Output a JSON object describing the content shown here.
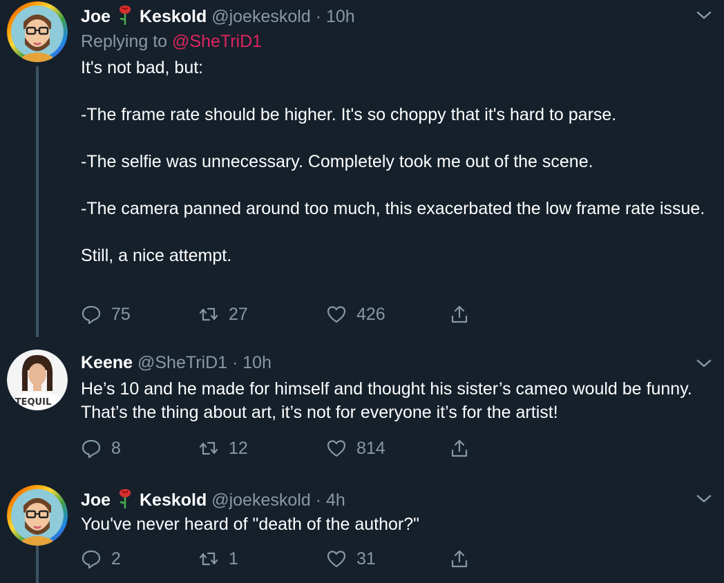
{
  "tweets": [
    {
      "first_name": "Joe",
      "last_name": "Keskold",
      "handle": "@joekeskold",
      "time": "· 10h",
      "replying_prefix": "Replying to",
      "replying_handle": "@SheTriD1",
      "paragraphs": [
        "It's not bad, but:",
        "-The frame rate should be higher. It's so choppy that it's hard to parse.",
        "-The selfie was unnecessary. Completely took me out of the scene.",
        "-The camera panned around too much, this exacerbated the low frame rate issue.",
        "Still, a nice attempt."
      ],
      "replies": "75",
      "retweets": "27",
      "likes": "426"
    },
    {
      "name": "Keene",
      "handle": "@SheTriD1",
      "time": "· 10h",
      "paragraphs": [
        "He’s 10 and he made for himself and thought his sister’s cameo would be funny. That’s the thing about art, it’s not for everyone it’s for the artist!"
      ],
      "avatar_text": "TEQUIL",
      "replies": "8",
      "retweets": "12",
      "likes": "814"
    },
    {
      "first_name": "Joe",
      "last_name": "Keskold",
      "handle": "@joekeskold",
      "time": "· 4h",
      "paragraphs": [
        "You've never heard of \"death of the author?\""
      ],
      "replies": "2",
      "retweets": "1",
      "likes": "31"
    }
  ],
  "colors": {
    "background": "#15202b",
    "muted": "#8899a6",
    "link": "#e0245e",
    "thread_line": "#3d5466"
  }
}
